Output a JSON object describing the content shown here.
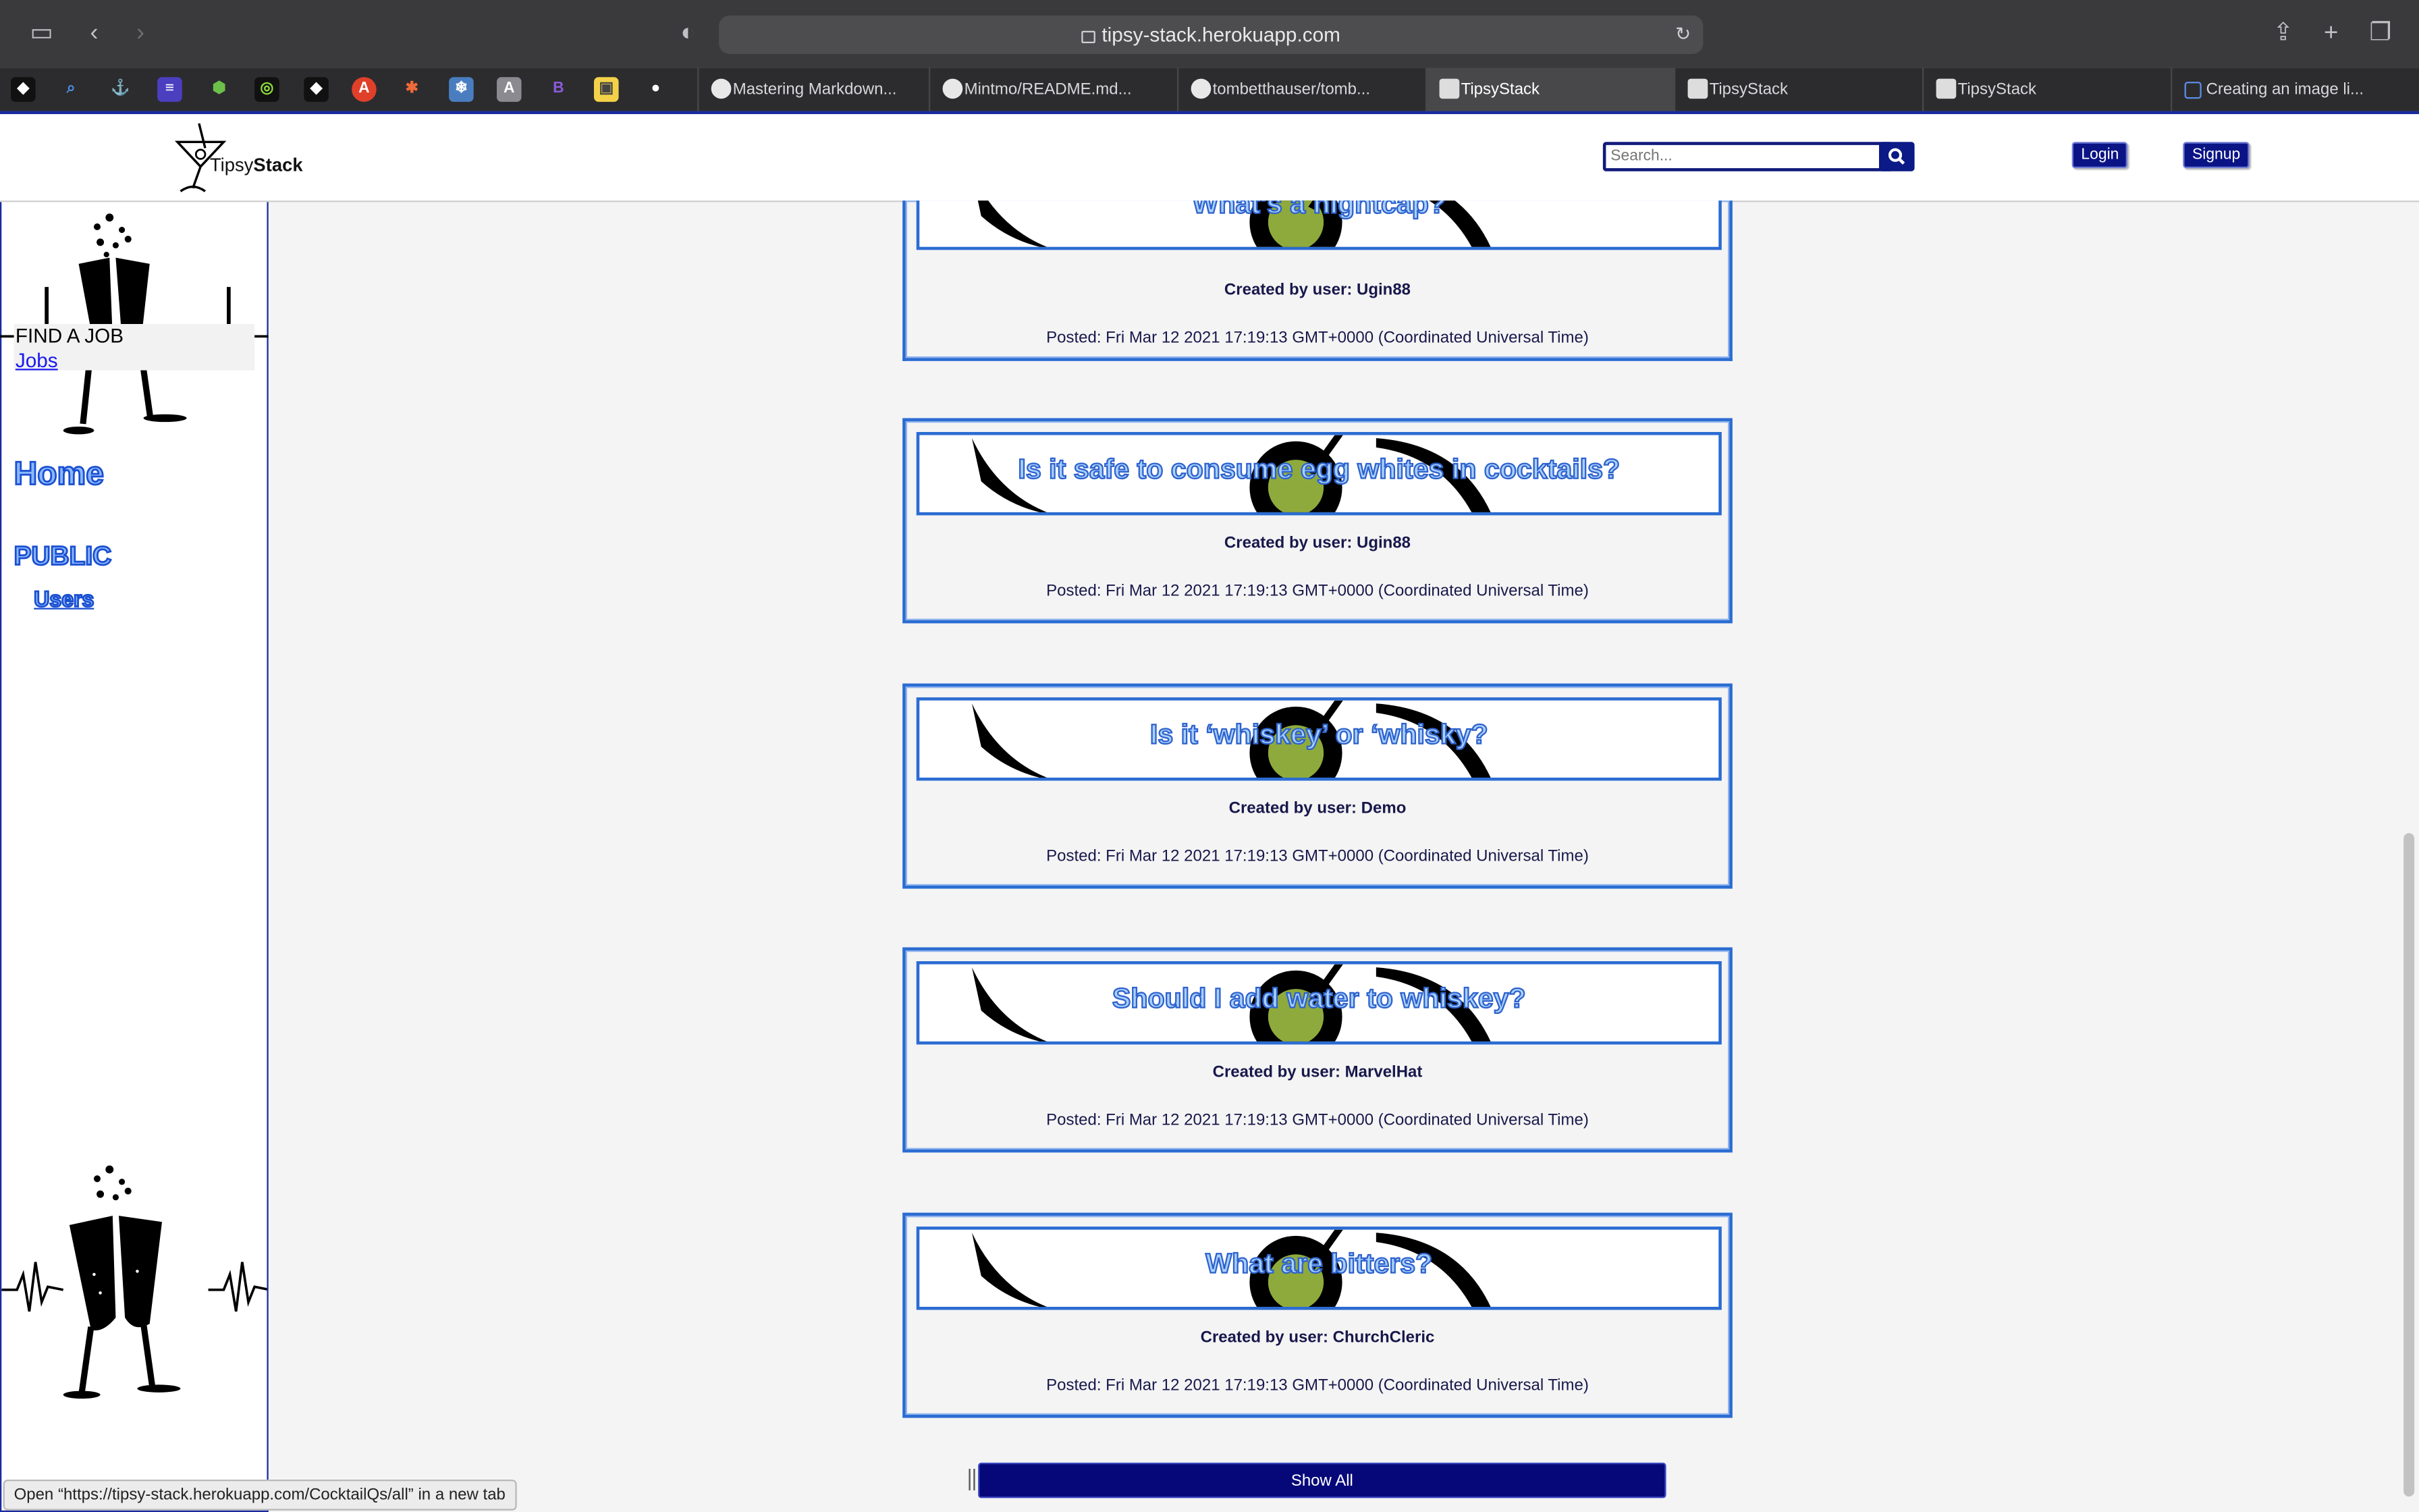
{
  "browser": {
    "url": "tipsy-stack.herokuapp.com",
    "tabs": [
      {
        "label": "Mastering Markdown...",
        "active": false
      },
      {
        "label": "Mintmo/README.md...",
        "active": false
      },
      {
        "label": "tombetthauser/tomb...",
        "active": false
      },
      {
        "label": "TipsyStack",
        "active": true
      },
      {
        "label": "TipsyStack",
        "active": false
      },
      {
        "label": "TipsyStack",
        "active": false
      },
      {
        "label": "Creating an image li...",
        "active": false
      }
    ],
    "status_text": "Open “https://tipsy-stack.herokuapp.com/CocktailQs/all” in a new tab"
  },
  "header": {
    "logo_tipsy": "Tipsy",
    "logo_stack": "Stack",
    "search_placeholder": "Search...",
    "login_label": "Login",
    "signup_label": "Signup"
  },
  "sidebar": {
    "job_title": "FIND A JOB",
    "job_link": "Jobs",
    "home": "Home",
    "public": "PUBLIC",
    "users": "Users"
  },
  "questions": [
    {
      "title": "What's a nightcap?",
      "creator": "Created by user: Ugin88",
      "posted": "Posted: Fri Mar 12 2021 17:19:13 GMT+0000 (Coordinated Universal Time)"
    },
    {
      "title": "Is it safe to consume egg whites in cocktails?",
      "creator": "Created by user: Ugin88",
      "posted": "Posted: Fri Mar 12 2021 17:19:13 GMT+0000 (Coordinated Universal Time)"
    },
    {
      "title": "Is it ‘whiskey’ or ‘whisky?",
      "creator": "Created by user: Demo",
      "posted": "Posted: Fri Mar 12 2021 17:19:13 GMT+0000 (Coordinated Universal Time)"
    },
    {
      "title": "Should I add water to whiskey?",
      "creator": "Created by user: MarvelHat",
      "posted": "Posted: Fri Mar 12 2021 17:19:13 GMT+0000 (Coordinated Universal Time)"
    },
    {
      "title": "What are bitters?",
      "creator": "Created by user: ChurchCleric",
      "posted": "Posted: Fri Mar 12 2021 17:19:13 GMT+0000 (Coordinated Universal Time)"
    }
  ],
  "show_all_label": "Show All",
  "colors": {
    "brand_navy": "#0b1485",
    "card_border": "#2b6cd2",
    "title_fill": "#a9d0ff",
    "olive": "#8faa3c"
  }
}
